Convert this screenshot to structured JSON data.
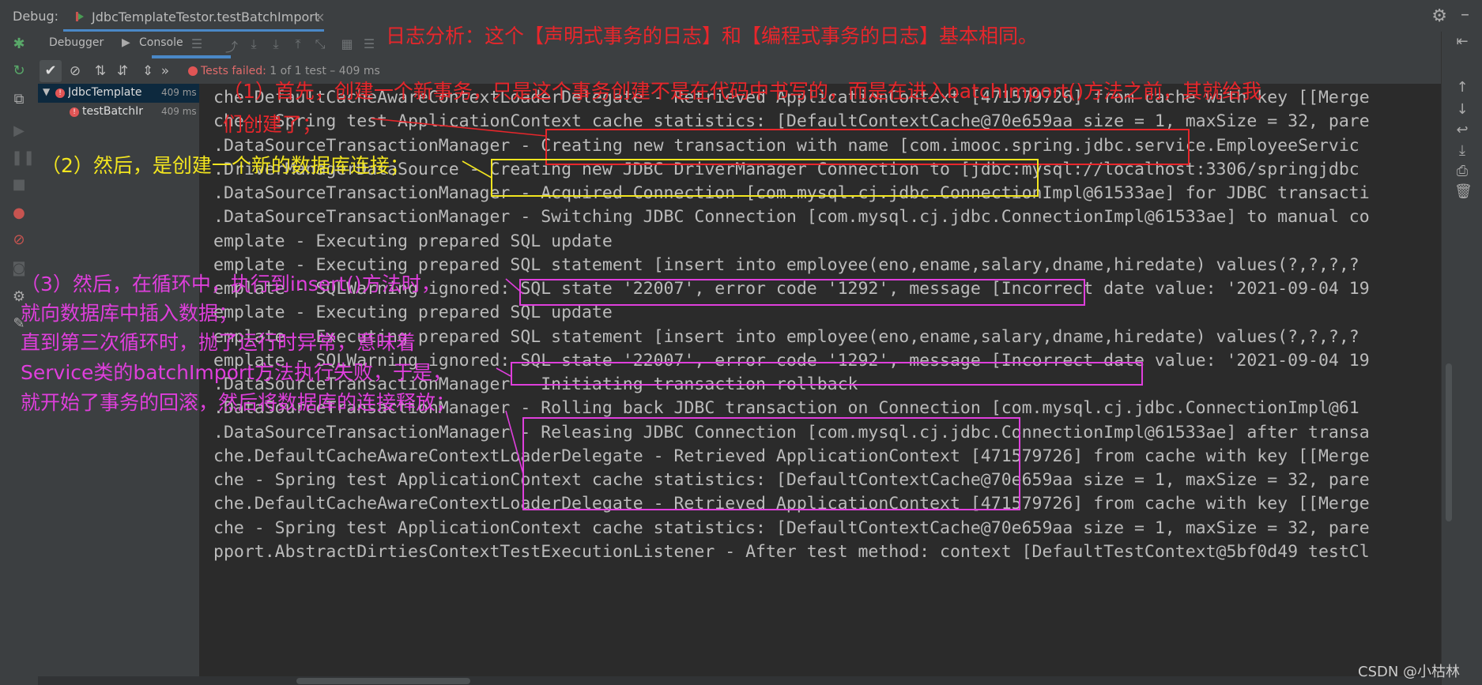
{
  "header": {
    "debug_label": "Debug:",
    "run_tab_title": "JdbcTemplateTestor.testBatchImport",
    "close_glyph": "×"
  },
  "tabs": {
    "debugger": "Debugger",
    "console": "Console"
  },
  "test_status": {
    "label": "Tests failed:",
    "detail": " 1 of 1 test – 409 ms"
  },
  "tree": {
    "root_name": "JdbcTemplate",
    "root_time": "409 ms",
    "child_name": "testBatchIr",
    "child_time": "409 ms"
  },
  "console_lines": [
    "che.DefaultCacheAwareContextLoaderDelegate - Retrieved ApplicationContext [471579726] from cache with key [[Merge",
    "che - Spring test ApplicationContext cache statistics: [DefaultContextCache@70e659aa size = 1, maxSize = 32, pare",
    ".DataSourceTransactionManager - Creating new transaction with name [com.imooc.spring.jdbc.service.EmployeeServic",
    ".DriverManagerDataSource - Creating new JDBC DriverManager Connection to [jdbc:mysql://localhost:3306/springjdbc",
    ".DataSourceTransactionManager - Acquired Connection [com.mysql.cj.jdbc.ConnectionImpl@61533ae] for JDBC transacti",
    ".DataSourceTransactionManager - Switching JDBC Connection [com.mysql.cj.jdbc.ConnectionImpl@61533ae] to manual co",
    "emplate - Executing prepared SQL update",
    "emplate - Executing prepared SQL statement [insert into employee(eno,ename,salary,dname,hiredate) values(?,?,?,?",
    "emplate - SQLWarning ignored: SQL state '22007', error code '1292', message [Incorrect date value: '2021-09-04 19",
    "emplate - Executing prepared SQL update",
    "emplate - Executing prepared SQL statement [insert into employee(eno,ename,salary,dname,hiredate) values(?,?,?,?",
    "emplate - SQLWarning ignored: SQL state '22007', error code '1292', message [Incorrect date value: '2021-09-04 19",
    ".DataSourceTransactionManager - Initiating transaction rollback",
    ".DataSourceTransactionManager - Rolling back JDBC transaction on Connection [com.mysql.cj.jdbc.ConnectionImpl@61",
    ".DataSourceTransactionManager - Releasing JDBC Connection [com.mysql.cj.jdbc.ConnectionImpl@61533ae] after transa",
    "che.DefaultCacheAwareContextLoaderDelegate - Retrieved ApplicationContext [471579726] from cache with key [[Merge",
    "che - Spring test ApplicationContext cache statistics: [DefaultContextCache@70e659aa size = 1, maxSize = 32, pare",
    "che.DefaultCacheAwareContextLoaderDelegate - Retrieved ApplicationContext [471579726] from cache with key [[Merge",
    "che - Spring test ApplicationContext cache statistics: [DefaultContextCache@70e659aa size = 1, maxSize = 32, pare",
    "pport.AbstractDirtiesContextTestExecutionListener - After test method: context [DefaultTestContext@5bf0d49 testCl"
  ],
  "annotations": {
    "title": "日志分析：这个【声明式事务的日志】和【编程式事务的日志】基本相同。",
    "step1_line1": "（1）首先，创建一个新事务，只是这个事务创建不是在代码中书写的，而是在进入batchImport()方法之前，其就给我",
    "step1_line2": "们创建了；",
    "step2": "（2）然后，是创建一个新的数据库连接；",
    "step3_line1": "（3）然后，在循环中，执行到insert()方法时，",
    "step3_line2": "就向数据库中插入数据；",
    "step3_line3": "直到第三次循环时，抛了运行时异常，意味着",
    "step3_line4": "Service类的batchImport方法执行失败，于是，",
    "step3_line5": "就开始了事务的回滚，然后将数据库的连接释放；"
  },
  "colors": {
    "red": "#e8262b",
    "yellow": "#f2e51f",
    "magenta": "#df3fdc"
  },
  "watermark": "CSDN @小枯林"
}
